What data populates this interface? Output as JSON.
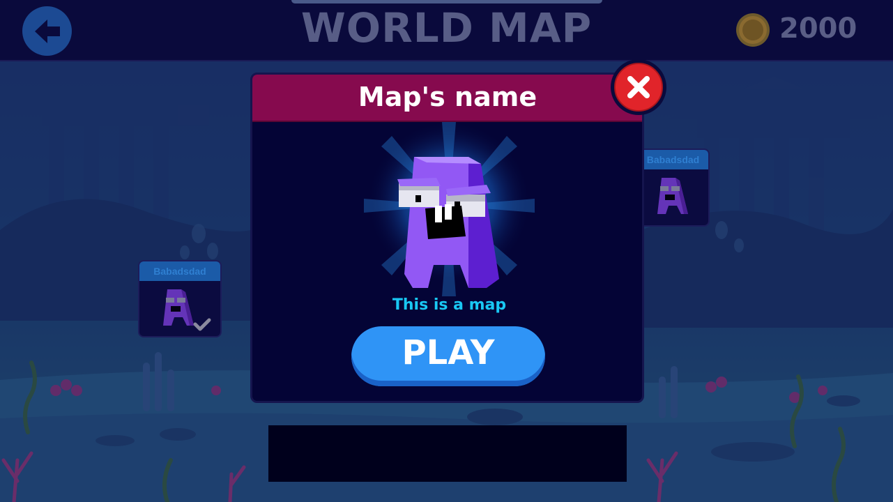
{
  "header": {
    "title": "WORLD MAP",
    "coins": "2000"
  },
  "level_cards": [
    {
      "title": "Babadsdad",
      "completed": true
    },
    {
      "title": "Babadsdad",
      "completed": false
    }
  ],
  "modal": {
    "title": "Map's name",
    "description": "This is a map",
    "play_label": "PLAY"
  },
  "colors": {
    "modal_header": "#860a4e",
    "play_button": "#2f94f6",
    "close_button": "#e1242a",
    "description_text": "#19c8f4",
    "character_purple": "#8a4ef0"
  },
  "icons": {
    "back": "arrow-left-icon",
    "coin": "coin-icon",
    "close": "close-icon",
    "check": "checkmark-icon"
  }
}
